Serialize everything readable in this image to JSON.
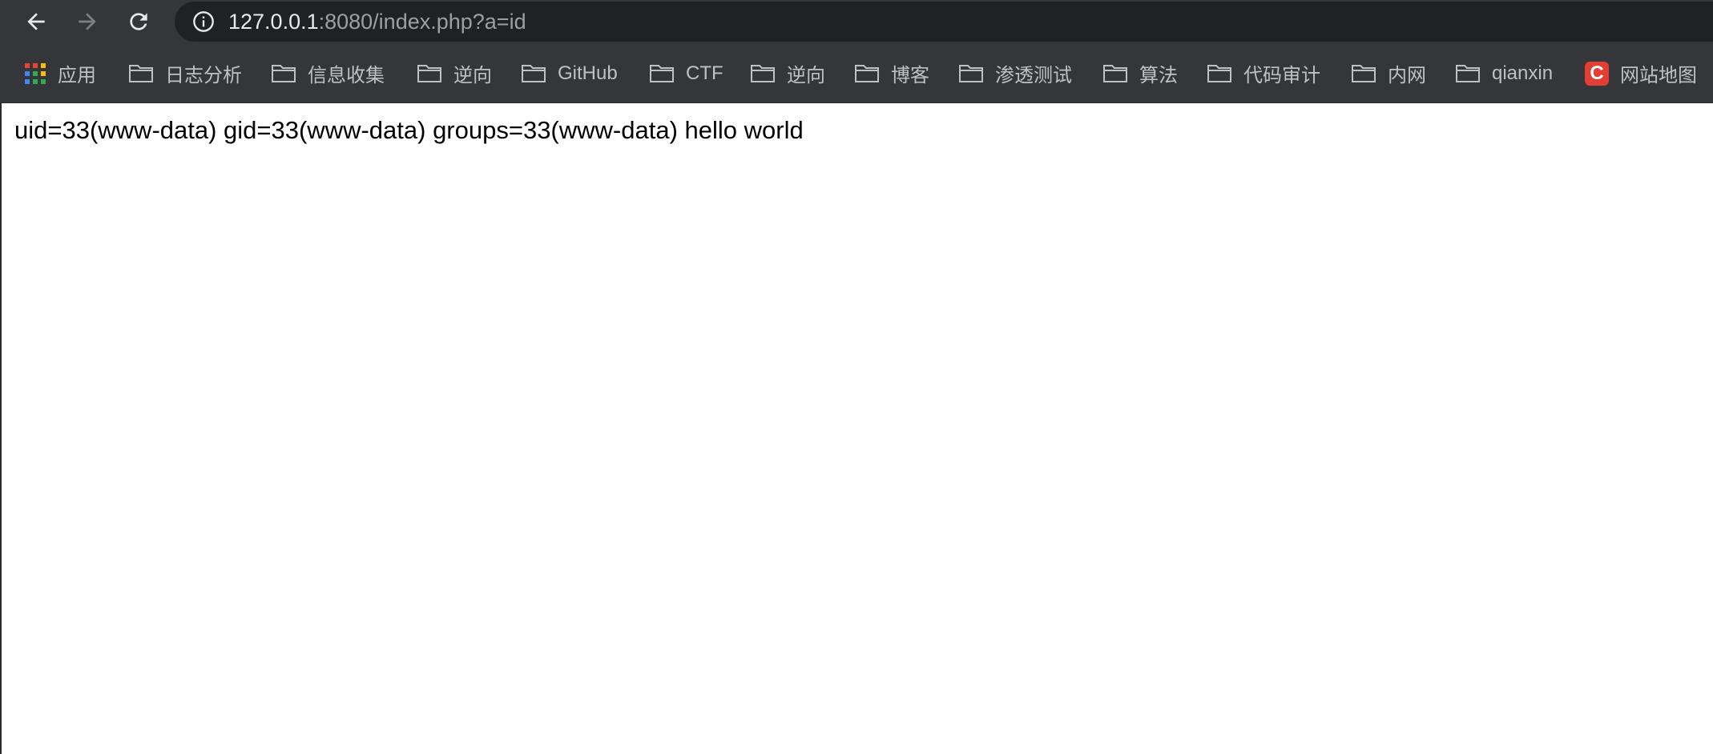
{
  "browser": {
    "url_host": "127.0.0.1",
    "url_rest": ":8080/index.php?a=id",
    "icons": {
      "back": "arrow-left-icon",
      "forward": "arrow-right-icon",
      "reload": "reload-icon",
      "site_info": "info-icon"
    }
  },
  "bookmarks": {
    "apps_label": "应用",
    "items": [
      {
        "label": "日志分析",
        "icon": "folder-icon"
      },
      {
        "label": "信息收集",
        "icon": "folder-icon"
      },
      {
        "label": "逆向",
        "icon": "folder-icon"
      },
      {
        "label": "GitHub",
        "icon": "folder-icon"
      },
      {
        "label": "CTF",
        "icon": "folder-icon"
      },
      {
        "label": "逆向",
        "icon": "folder-icon"
      },
      {
        "label": "博客",
        "icon": "folder-icon"
      },
      {
        "label": "渗透测试",
        "icon": "folder-icon"
      },
      {
        "label": "算法",
        "icon": "folder-icon"
      },
      {
        "label": "代码审计",
        "icon": "folder-icon"
      },
      {
        "label": "内网",
        "icon": "folder-icon"
      },
      {
        "label": "qianxin",
        "icon": "folder-icon"
      }
    ],
    "sitemap": {
      "label": "网站地图",
      "icon_letter": "C",
      "icon_color": "#e33e33"
    }
  },
  "page": {
    "output_text": "uid=33(www-data) gid=33(www-data) groups=33(www-data) hello world"
  },
  "colors": {
    "toolbar_bg": "#35363a",
    "omnibox_bg": "#202124",
    "bookmark_text": "#bdc1c6",
    "page_bg": "#ffffff"
  }
}
